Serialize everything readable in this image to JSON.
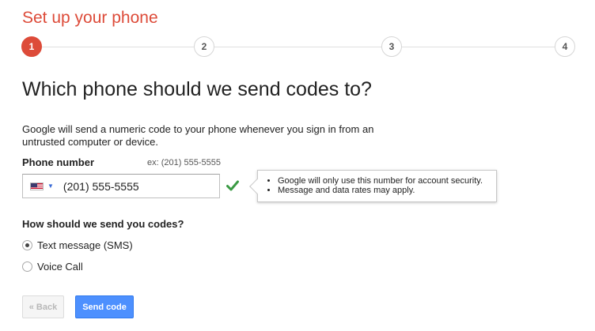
{
  "page": {
    "title": "Set up your phone"
  },
  "stepper": {
    "steps": [
      {
        "number": "1",
        "active": true
      },
      {
        "number": "2",
        "active": false
      },
      {
        "number": "3",
        "active": false
      },
      {
        "number": "4",
        "active": false
      }
    ]
  },
  "main": {
    "heading": "Which phone should we send codes to?",
    "description": "Google will send a numeric code to your phone whenever you sign in from an untrusted computer or device.",
    "phone": {
      "label": "Phone number",
      "example": "ex: (201) 555-5555",
      "country_icon": "us-flag-icon",
      "value": "(201) 555-5555",
      "valid_icon": "checkmark-icon",
      "valid_color": "#3a9a43"
    },
    "tooltip": {
      "items": [
        "Google will only use this number for account security.",
        "Message and data rates may apply."
      ]
    },
    "delivery": {
      "label": "How should we send you codes?",
      "options": [
        {
          "label": "Text message (SMS)",
          "selected": true
        },
        {
          "label": "Voice Call",
          "selected": false
        }
      ]
    }
  },
  "actions": {
    "back_label": "« Back",
    "primary_label": "Send code",
    "primary_color": "#4d90fe",
    "accent_color": "#dd4b39"
  }
}
